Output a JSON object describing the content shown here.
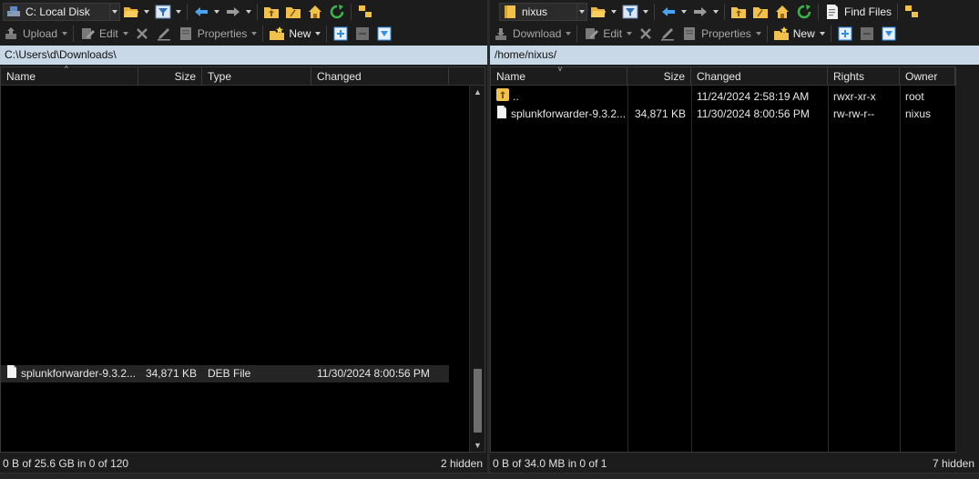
{
  "colors": {
    "path_bar": "#c9d8e6",
    "folder_yellow": "#f2c14b",
    "accent_blue": "#2f8ee6",
    "refresh_green": "#3cb64a"
  },
  "left": {
    "drive_label": "C: Local Disk",
    "toolbar": {
      "upload_label": "Upload",
      "edit_label": "Edit",
      "properties_label": "Properties",
      "new_label": "New"
    },
    "path": "C:\\Users\\d\\Downloads\\",
    "columns": [
      "Name",
      "Size",
      "Type",
      "Changed"
    ],
    "files": [
      {
        "name": "splunkforwarder-9.3.2...",
        "size": "34,871 KB",
        "type": "DEB File",
        "changed": "11/30/2024 8:00:56 PM"
      }
    ],
    "status": "0 B of 25.6 GB in 0 of 120",
    "hidden": "2 hidden"
  },
  "right": {
    "drive_label": "nixus",
    "toolbar": {
      "find_files_label": "Find Files",
      "download_label": "Download",
      "edit_label": "Edit",
      "properties_label": "Properties",
      "new_label": "New"
    },
    "path": "/home/nixus/",
    "columns": [
      "Name",
      "Size",
      "Changed",
      "Rights",
      "Owner"
    ],
    "files": [
      {
        "name": "..",
        "size": "",
        "changed": "11/24/2024 2:58:19 AM",
        "rights": "rwxr-xr-x",
        "owner": "root"
      },
      {
        "name": "splunkforwarder-9.3.2...",
        "size": "34,871 KB",
        "changed": "11/30/2024 8:00:56 PM",
        "rights": "rw-rw-r--",
        "owner": "nixus"
      }
    ],
    "status": "0 B of 34.0 MB in 0 of 1",
    "hidden": "7 hidden"
  },
  "icons": [
    "local-disk-icon",
    "open-folder-icon",
    "filter-icon",
    "back-arrow-icon",
    "forward-arrow-icon",
    "parent-folder-icon",
    "root-folder-icon",
    "home-icon",
    "refresh-icon",
    "sync-browse-icon",
    "upload-icon",
    "edit-icon",
    "delete-icon",
    "rename-icon",
    "properties-icon",
    "new-icon",
    "plus-icon",
    "minus-icon",
    "select-icon",
    "server-folder-icon",
    "find-files-icon",
    "download-icon",
    "file-icon",
    "parent-dir-icon"
  ]
}
